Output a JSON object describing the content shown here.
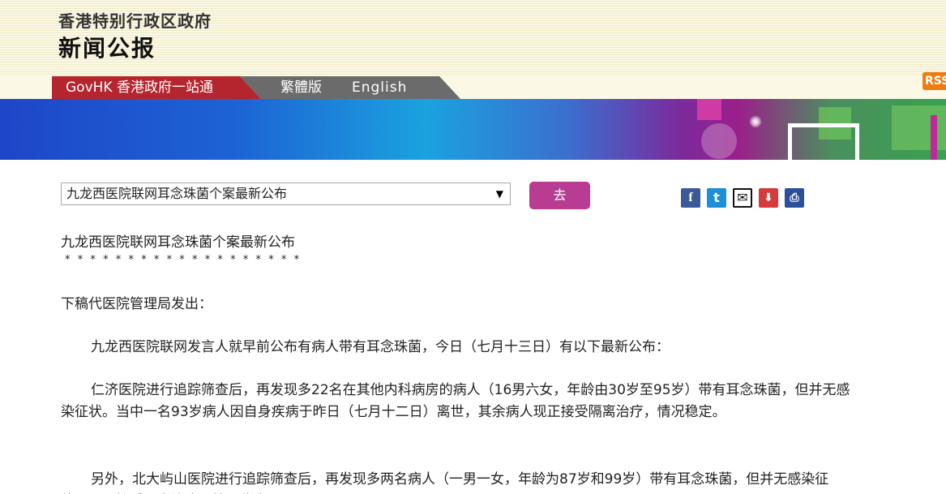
{
  "header": {
    "gov_name": "香港特别行政区政府",
    "press_title": "新闻公报"
  },
  "nav": {
    "govhk": "GovHK 香港政府一站通",
    "traditional": "繁體版",
    "english": "English",
    "rss": "RSS"
  },
  "colors": {
    "govhk_red": "#b5252e",
    "go_button": "#b73c92",
    "rss_orange": "#f07b0f"
  },
  "toolbar": {
    "select_value": "九龙西医院联网耳念珠菌个案最新公布",
    "select_arrow": "▼",
    "go_label": "去",
    "share_icons": [
      "facebook-icon",
      "twitter-icon",
      "email-icon",
      "pdf-icon",
      "print-icon"
    ],
    "share_glyphs": {
      "facebook": "f",
      "twitter": "t",
      "email": "✉",
      "pdf": "⬇",
      "print": "⎙"
    }
  },
  "article": {
    "title": "九龙西医院联网耳念珠菌个案最新公布",
    "stars": "*******************",
    "source": "下稿代医院管理局发出：",
    "paragraphs": [
      "九龙西医院联网发言人就早前公布有病人带有耳念珠菌，今日（七月十三日）有以下最新公布：",
      "仁济医院进行追踪筛查后，再发现多22名在其他内科病房的病人（16男六女，年龄由30岁至95岁）带有耳念珠菌，但并无感染征状。当中一名93岁病人因自身疾病于昨日（七月十二日）离世，其余病人现正接受隔离治疗，情况稳定。",
      "另外，北大屿山医院进行追踪筛查后，再发现多两名病人（一男一女，年龄为87岁和99岁）带有耳念珠菌，但并无感染征状，现正接受隔离治疗，情况稳定。"
    ]
  }
}
